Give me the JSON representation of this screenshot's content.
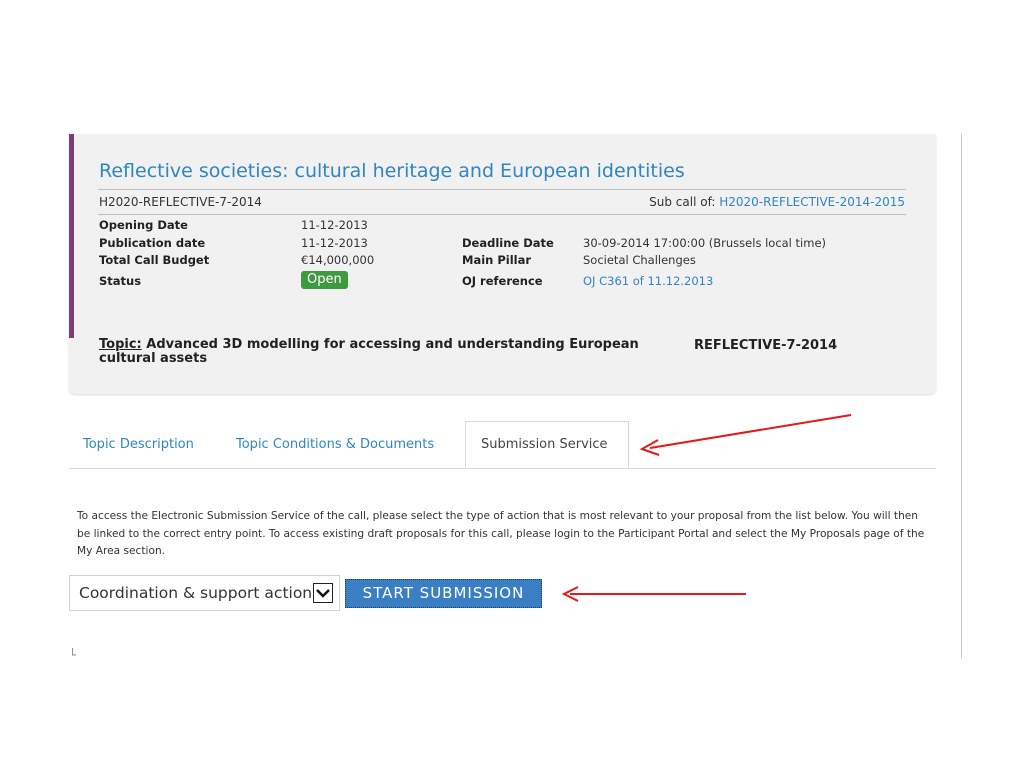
{
  "call": {
    "title": "Reflective societies: cultural heritage and European identities",
    "identifier": "H2020-REFLECTIVE-7-2014",
    "subcall_prefix": "Sub call of: ",
    "subcall_link": "H2020-REFLECTIVE-2014-2015"
  },
  "details": {
    "opening_date_label": "Opening Date",
    "opening_date_value": "11-12-2013",
    "publication_date_label": "Publication date",
    "publication_date_value": "11-12-2013",
    "budget_label": "Total Call Budget",
    "budget_value": "€14,000,000",
    "status_label": "Status",
    "status_value": "Open",
    "deadline_label": "Deadline Date",
    "deadline_value": "30-09-2014 17:00:00 (Brussels local time)",
    "pillar_label": "Main Pillar",
    "pillar_value": "Societal Challenges",
    "oj_label": "OJ reference",
    "oj_value": "OJ C361 of 11.12.2013"
  },
  "topic": {
    "label": "Topic:",
    "text": " Advanced 3D modelling for accessing and understanding European cultural assets",
    "code": "REFLECTIVE-7-2014"
  },
  "tabs": [
    {
      "label": "Topic Description"
    },
    {
      "label": "Topic Conditions & Documents"
    },
    {
      "label": "Submission Service"
    }
  ],
  "submission": {
    "intro": "To access the Electronic Submission Service of the call, please select the type of action that is most relevant to your proposal from the list below. You will then be linked to the correct entry point. To access existing draft proposals for this call, please login to the Participant Portal and select the My Proposals page of the My Area section.",
    "selected_action": "Coordination & support action",
    "button_label": "START SUBMISSION"
  },
  "colors": {
    "accent": "#7b3f76",
    "link": "#2f86c2",
    "status_green": "#3e9a3e",
    "button_blue": "#3a7fc4",
    "annotation_arrow": "#e21a1a"
  },
  "icons": {
    "select_arrow": "chevron-down-icon",
    "arrow_1": "red-arrow-icon",
    "arrow_2": "red-arrow-icon"
  }
}
